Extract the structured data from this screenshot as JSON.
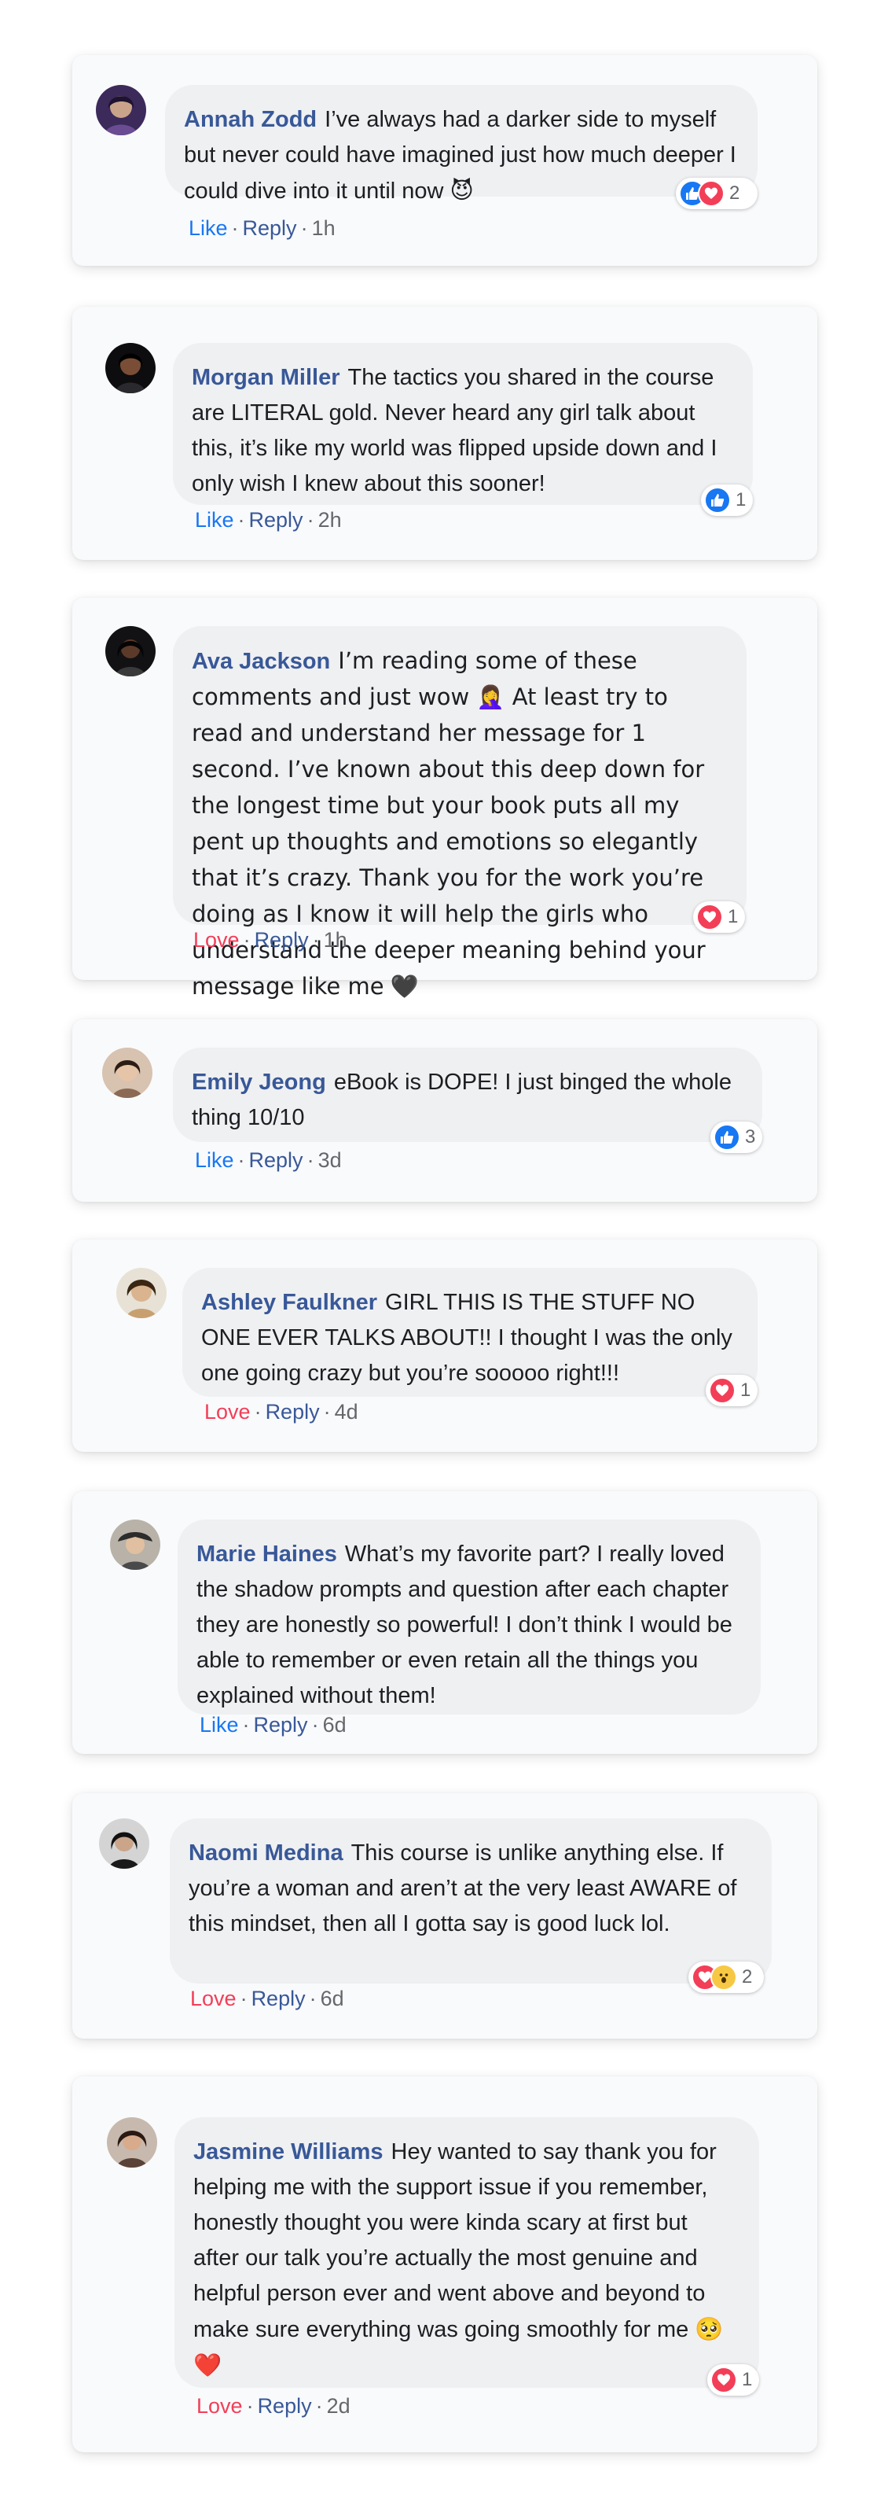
{
  "comments": [
    {
      "name": "Annah Zodd",
      "text": "I’ve always had a darker side to myself but never could have imagined just how much deeper I could dive into it until now",
      "emoji": "😈",
      "reactions": [
        "like",
        "love"
      ],
      "reaction_count": "2",
      "action": "Like",
      "reply": "Reply",
      "time": "1h"
    },
    {
      "name": "Morgan Miller",
      "text": "The tactics you shared in the course are LITERAL gold. Never heard any girl talk about this, it’s like my world was flipped upside down and I only wish I knew about this sooner!",
      "emoji": "",
      "reactions": [
        "like"
      ],
      "reaction_count": "1",
      "action": "Like",
      "reply": "Reply",
      "time": "2h"
    },
    {
      "name": "Ava Jackson",
      "text": "I’m reading some of these comments and just wow 🤦‍♀️ At least try to read and understand her message for 1 second. I’ve known about this deep down for the longest time but your book puts all my pent up thoughts and emotions so elegantly that it’s crazy. Thank you for the work you’re doing as I know it will help the girls who understand the deeper meaning behind your message like me",
      "emoji": "🖤",
      "reactions": [
        "love"
      ],
      "reaction_count": "1",
      "action": "Love",
      "reply": "Reply",
      "time": "1h"
    },
    {
      "name": "Emily Jeong",
      "text": "eBook is DOPE! I just binged the whole thing 10/10",
      "emoji": "",
      "reactions": [
        "like"
      ],
      "reaction_count": "3",
      "action": "Like",
      "reply": "Reply",
      "time": "3d"
    },
    {
      "name": "Ashley Faulkner",
      "text": "GIRL THIS IS THE STUFF NO ONE EVER TALKS ABOUT!! I thought I was the only one going crazy but you’re sooooo right!!!",
      "emoji": "",
      "reactions": [
        "love"
      ],
      "reaction_count": "1",
      "action": "Love",
      "reply": "Reply",
      "time": "4d"
    },
    {
      "name": "Marie Haines",
      "text": "What’s my favorite part? I really loved the shadow prompts and question after each chapter they are honestly so powerful! I don’t think I would be able to remember or even retain all the things you explained without them!",
      "emoji": "",
      "reactions": [],
      "reaction_count": "",
      "action": "Like",
      "reply": "Reply",
      "time": "6d"
    },
    {
      "name": "Naomi Medina",
      "text": "This course is unlike anything else. If you’re a woman and aren’t at the very least AWARE of this mindset, then all I gotta say is good luck lol.",
      "emoji": "",
      "reactions": [
        "love",
        "wow"
      ],
      "reaction_count": "2",
      "action": "Love",
      "reply": "Reply",
      "time": "6d"
    },
    {
      "name": "Jasmine Williams",
      "text": "Hey wanted to say thank you for helping me with the support issue if you remember, honestly thought you were kinda scary at first but after our talk you’re actually the most genuine and helpful person ever and went above and beyond to make sure everything was going smoothly for me",
      "emoji": "🥺 ❤️",
      "reactions": [
        "love"
      ],
      "reaction_count": "1",
      "action": "Love",
      "reply": "Reply",
      "time": "2d"
    }
  ],
  "colors": {
    "name": "#385898",
    "like": "#1877f2",
    "love": "#f33e58",
    "wow": "#f7c843",
    "bubble": "#eff0f2",
    "card": "#f9fafc",
    "meta": "#65676b"
  },
  "icons": {
    "like": "thumbs-up-icon",
    "love": "heart-icon",
    "wow": "wow-face-icon"
  }
}
